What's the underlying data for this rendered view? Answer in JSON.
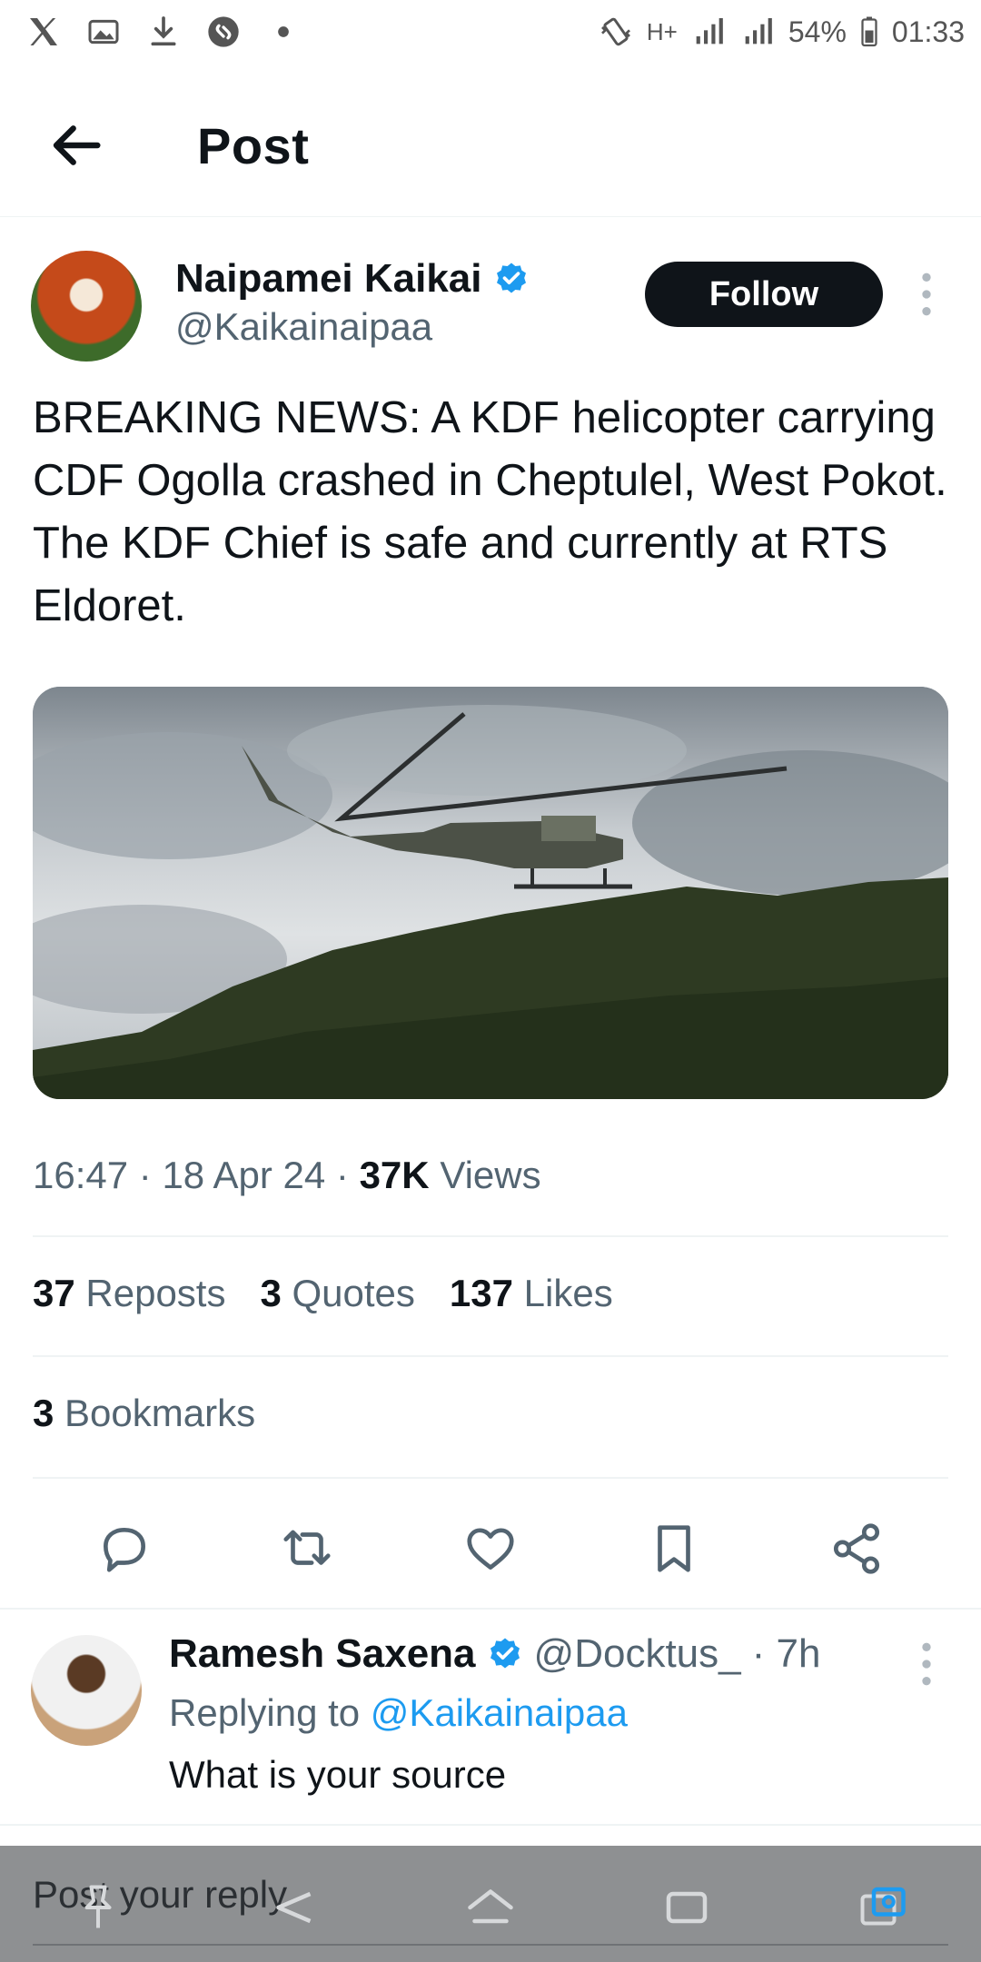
{
  "status_bar": {
    "battery": "54%",
    "time": "01:33",
    "network": "H+",
    "sim1": "1",
    "sim2": "2",
    "icons_left": [
      "x-logo-icon",
      "image-icon",
      "download-icon",
      "shazam-icon",
      "dot-icon"
    ],
    "icons_right": [
      "vibrate-icon",
      "network-icon",
      "signal-icon",
      "signal-icon",
      "battery-icon"
    ]
  },
  "header": {
    "title": "Post",
    "back_icon": "back-arrow-icon"
  },
  "post": {
    "author_name": "Naipamei Kaikai",
    "author_handle": "@Kaikainaipaa",
    "verified": true,
    "follow_label": "Follow",
    "text": "BREAKING NEWS: A KDF helicopter carrying CDF Ogolla crashed in Cheptulel, West Pokot. The KDF Chief is safe and currently at RTS Eldoret.",
    "media_icon": "helicopter-photo",
    "time": "16:47",
    "date": "18 Apr 24",
    "views_count": "37K",
    "views_label": "Views",
    "stats": {
      "reposts_count": "37",
      "reposts_label": "Reposts",
      "quotes_count": "3",
      "quotes_label": "Quotes",
      "likes_count": "137",
      "likes_label": "Likes"
    },
    "bookmarks_count": "3",
    "bookmarks_label": "Bookmarks",
    "actions": [
      "reply-icon",
      "repost-icon",
      "like-icon",
      "bookmark-icon",
      "share-icon"
    ]
  },
  "reply": {
    "author_name": "Ramesh Saxena",
    "author_handle": "@Docktus_",
    "age": "· 7h",
    "replying_label": "Replying to",
    "replying_handle": "@Kaikainaipaa",
    "text": "What is your source",
    "verified": true
  },
  "composer": {
    "placeholder": "Post your reply"
  },
  "colors": {
    "accent": "#1d9bf0",
    "text": "#0f1419",
    "secondary": "#536471",
    "verified": "#1d9bf0"
  }
}
